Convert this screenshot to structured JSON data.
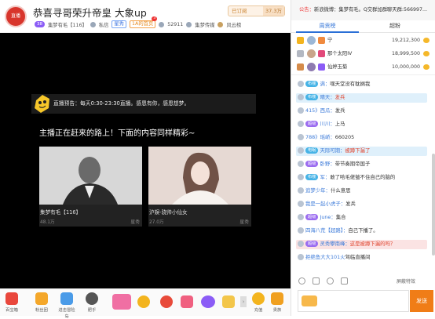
{
  "header": {
    "logo_text": "直播",
    "title": "恭喜寻哥荣升帝皇 大象up",
    "follow_label": "已订阅",
    "follow_count": "37.3万",
    "level": "38",
    "streamer": "集梦有毛【116】",
    "room_label": "私信",
    "tag": "星秀",
    "tag2": "1A的首页",
    "tag2_badge": "3",
    "viewers": "52911",
    "guild": "集梦传媒",
    "share": "风云榜"
  },
  "video": {
    "notice_label": "直播预告",
    "notice_text": "每天0:30-23:30直播。感恩有你，感恩想梦。",
    "main_message": "主播正在赶来的路上！下面的内容同样精彩~",
    "cards": [
      {
        "name": "集梦有毛【116】",
        "count": "48.1万",
        "category": "星秀"
      },
      {
        "name": "沪娱-骁帅小仙女",
        "count": "27.0万",
        "category": "星秀"
      }
    ]
  },
  "bottom_bar": {
    "items": [
      "百宝箱",
      "粉丝团",
      "进击冒险岛",
      "肥乎"
    ],
    "right_items": [
      "充值",
      "贵族"
    ]
  },
  "sidebar": {
    "notice": {
      "prefix": "公告：",
      "text": "新浪微博：集梦有毛。Q交群加群聊天群:566997..."
    },
    "tabs": [
      "周贡榜",
      "超粉"
    ],
    "ranking": [
      {
        "rank_color": "#f3b41e",
        "level_color": "#f08a3e",
        "name": "宁",
        "score": "19,212,300"
      },
      {
        "rank_color": "#b3b8c2",
        "level_color": "#e2497a",
        "name": "那个太阳IV",
        "score": "18,999,500"
      },
      {
        "rank_color": "#d58b4a",
        "level_color": "#8b5cf6",
        "name": "仙婷玉菊",
        "score": "10,000,000"
      }
    ],
    "chat": [
      {
        "badge": "布楼",
        "badge_color": "#46b3e6",
        "user": "满：",
        "text": "嘿天堂没有耽搁我",
        "hl": ""
      },
      {
        "badge": "布楼",
        "badge_color": "#46b3e6",
        "user": "晴天：",
        "text": "发兵",
        "hl": "#dff0fb"
      },
      {
        "badge": "",
        "badge_color": "",
        "user": "415》西瓜：",
        "text": "发兵",
        "hl": ""
      },
      {
        "badge": "超级",
        "badge_color": "#9b6cf0",
        "user": "川川：",
        "text": "上马",
        "hl": ""
      },
      {
        "badge": "",
        "badge_color": "",
        "user": "788》瑶峤：",
        "text": "660205",
        "hl": ""
      },
      {
        "badge": "电眠",
        "badge_color": "#46b3e6",
        "user": "天际可期：",
        "text": "被蹲下漏了",
        "hl": "#dff0fb"
      },
      {
        "badge": "超级",
        "badge_color": "#9b6cf0",
        "user": "卧野：",
        "text": "带节奏期帝国子",
        "hl": ""
      },
      {
        "badge": "布楼",
        "badge_color": "#46b3e6",
        "user": "军：",
        "text": "敢了哈毛佬皱不住自己的脑的",
        "hl": ""
      },
      {
        "badge": "",
        "badge_color": "",
        "user": "追梦少年：",
        "text": "什么意思",
        "hl": ""
      },
      {
        "badge": "",
        "badge_color": "",
        "user": "我是一起小虎子：",
        "text": "发兵",
        "hl": ""
      },
      {
        "badge": "超级",
        "badge_color": "#9b6cf0",
        "user": "June：",
        "text": "集合",
        "hl": ""
      },
      {
        "badge": "",
        "badge_color": "",
        "user": "四海八荒【超路】：",
        "text": "自己下播了。",
        "hl": ""
      },
      {
        "badge": "超级",
        "badge_color": "#9b6cf0",
        "user": "灵秀攀南峰：",
        "text": "这是被蹲下漏的吗？",
        "hl": "#fbe3e3"
      },
      {
        "badge": "",
        "badge_color": "",
        "user": "拒绝鱼大大101火",
        "text": "驾临直播间",
        "hl": ""
      }
    ],
    "tools_label": "屏蔽特效",
    "input_placeholder": "",
    "send_label": "发送"
  }
}
